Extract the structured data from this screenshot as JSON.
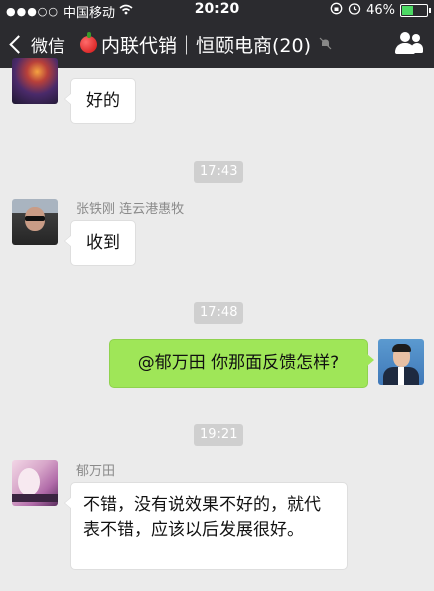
{
  "status_bar": {
    "signal": "●●●○○",
    "carrier": "中国移动",
    "time": "20:20",
    "battery": "46%",
    "battery_level": 0.46
  },
  "nav": {
    "back_label": "微信",
    "title": "内联代销｜恒颐电商(20)"
  },
  "messages": [
    {
      "side": "left",
      "text": "好的"
    },
    {
      "timestamp": "17:43"
    },
    {
      "side": "left",
      "sender": "张铁刚 连云港惠牧",
      "text": "收到"
    },
    {
      "timestamp": "17:48"
    },
    {
      "side": "right",
      "text": "@郁万田 你那面反馈怎样?"
    },
    {
      "timestamp": "19:21"
    },
    {
      "side": "left",
      "sender": "郁万田",
      "text": "不错，没有说效果不好的，就代表不错，应该以后发展很好。"
    }
  ]
}
